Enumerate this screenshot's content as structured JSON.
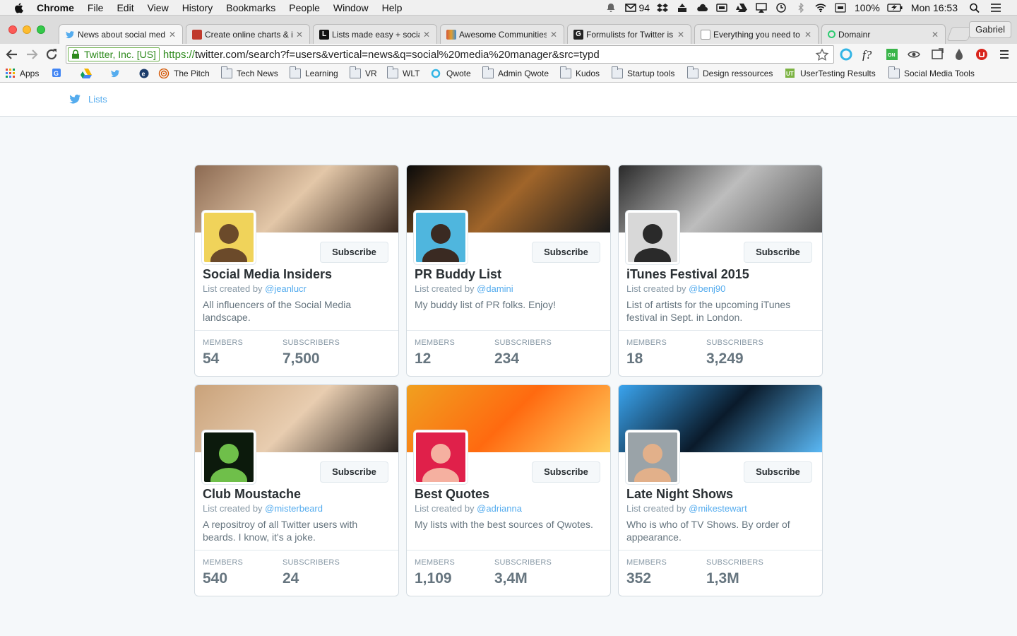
{
  "menubar": {
    "app": "Chrome",
    "menus": [
      "File",
      "Edit",
      "View",
      "History",
      "Bookmarks",
      "People",
      "Window",
      "Help"
    ],
    "mail_count": "94",
    "battery": "100%",
    "clock": "Mon 16:53"
  },
  "browser": {
    "profile": "Gabriel",
    "tabs": [
      {
        "title": "News about social media",
        "active": true,
        "favicon_color": "#55acee"
      },
      {
        "title": "Create online charts & infographics",
        "active": false,
        "favicon_color": "#c0392b"
      },
      {
        "title": "Lists made easy + social",
        "active": false,
        "favicon_color": "#111111"
      },
      {
        "title": "Awesome Communities",
        "active": false,
        "favicon_color": "#d35a3a"
      },
      {
        "title": "Formulists for Twitter is",
        "active": false,
        "favicon_color": "#222222"
      },
      {
        "title": "Everything you need to know",
        "active": false,
        "favicon_color": "#ffffff"
      },
      {
        "title": "Domainr",
        "active": false,
        "favicon_color": "#2ecc71"
      }
    ],
    "ev_cert": "Twitter, Inc. [US]",
    "url_scheme": "https://",
    "url_rest": "twitter.com/search?f=users&vertical=news&q=social%20media%20manager&src=typd",
    "bookmarks": [
      {
        "label": "Apps",
        "type": "apps"
      },
      {
        "label": "",
        "type": "translate"
      },
      {
        "label": "",
        "type": "drive"
      },
      {
        "label": "",
        "type": "twitter"
      },
      {
        "label": "",
        "type": "e"
      },
      {
        "label": "The Pitch",
        "type": "pitch"
      },
      {
        "label": "Tech News",
        "type": "folder"
      },
      {
        "label": "Learning",
        "type": "folder"
      },
      {
        "label": "VR",
        "type": "folder"
      },
      {
        "label": "WLT",
        "type": "folder"
      },
      {
        "label": "Qwote",
        "type": "qwote"
      },
      {
        "label": "Admin Qwote",
        "type": "folder"
      },
      {
        "label": "Kudos",
        "type": "folder"
      },
      {
        "label": "Startup tools",
        "type": "folder"
      },
      {
        "label": "Design ressources",
        "type": "folder"
      },
      {
        "label": "UserTesting Results",
        "type": "ut"
      },
      {
        "label": "Social Media Tools",
        "type": "folder"
      }
    ]
  },
  "page": {
    "header_link": "Lists",
    "subscribe_label": "Subscribe",
    "created_by_prefix": "List created by ",
    "members_label": "MEMBERS",
    "subscribers_label": "SUBSCRIBERS",
    "cards": [
      {
        "name": "Social Media Insiders",
        "handle": "@jeanlucr",
        "description": "All influencers of the Social Media landscape.",
        "members": "54",
        "subscribers": "7,500",
        "banner_colors": [
          "#8c6a52",
          "#e3c7a8",
          "#3a2a20"
        ],
        "avatar_colors": [
          "#f0d35a",
          "#6b4a2a"
        ]
      },
      {
        "name": "PR Buddy List",
        "handle": "@damini",
        "description": "My buddy list of PR folks. Enjoy!",
        "members": "12",
        "subscribers": "234",
        "banner_colors": [
          "#0a0a0a",
          "#a0652a",
          "#1a1a1a"
        ],
        "avatar_colors": [
          "#4fb6de",
          "#3a2a22"
        ]
      },
      {
        "name": "iTunes Festival 2015",
        "handle": "@benj90",
        "description": "List of artists for the upcoming iTunes festival in Sept. in London.",
        "members": "18",
        "subscribers": "3,249",
        "banner_colors": [
          "#2a2a2a",
          "#bdbdbd",
          "#555555"
        ],
        "avatar_colors": [
          "#d8d8d8",
          "#2a2a2a"
        ]
      },
      {
        "name": "Club Moustache",
        "handle": "@misterbeard",
        "description": "A repositroy of all Twitter users with beards. I know, it's a joke.",
        "members": "540",
        "subscribers": "24",
        "banner_colors": [
          "#c9a27a",
          "#e8cdb0",
          "#2b2420"
        ],
        "avatar_colors": [
          "#0c1a0c",
          "#6fbf4a"
        ]
      },
      {
        "name": "Best Quotes",
        "handle": "@adrianna",
        "description": "My lists with the best sources of Qwotes.",
        "members": "1,109",
        "subscribers": "3,4M",
        "banner_colors": [
          "#f0a020",
          "#ff6a10",
          "#ffd060"
        ],
        "avatar_colors": [
          "#e0204a",
          "#f5b0a0"
        ]
      },
      {
        "name": "Late Night Shows",
        "handle": "@mikestewart",
        "description": "Who is who of TV Shows. By order of appearance.",
        "members": "352",
        "subscribers": "1,3M",
        "banner_colors": [
          "#3aa4ee",
          "#0a1a2a",
          "#5ab8f5"
        ],
        "avatar_colors": [
          "#9aa3a8",
          "#e2b08a"
        ]
      }
    ]
  }
}
